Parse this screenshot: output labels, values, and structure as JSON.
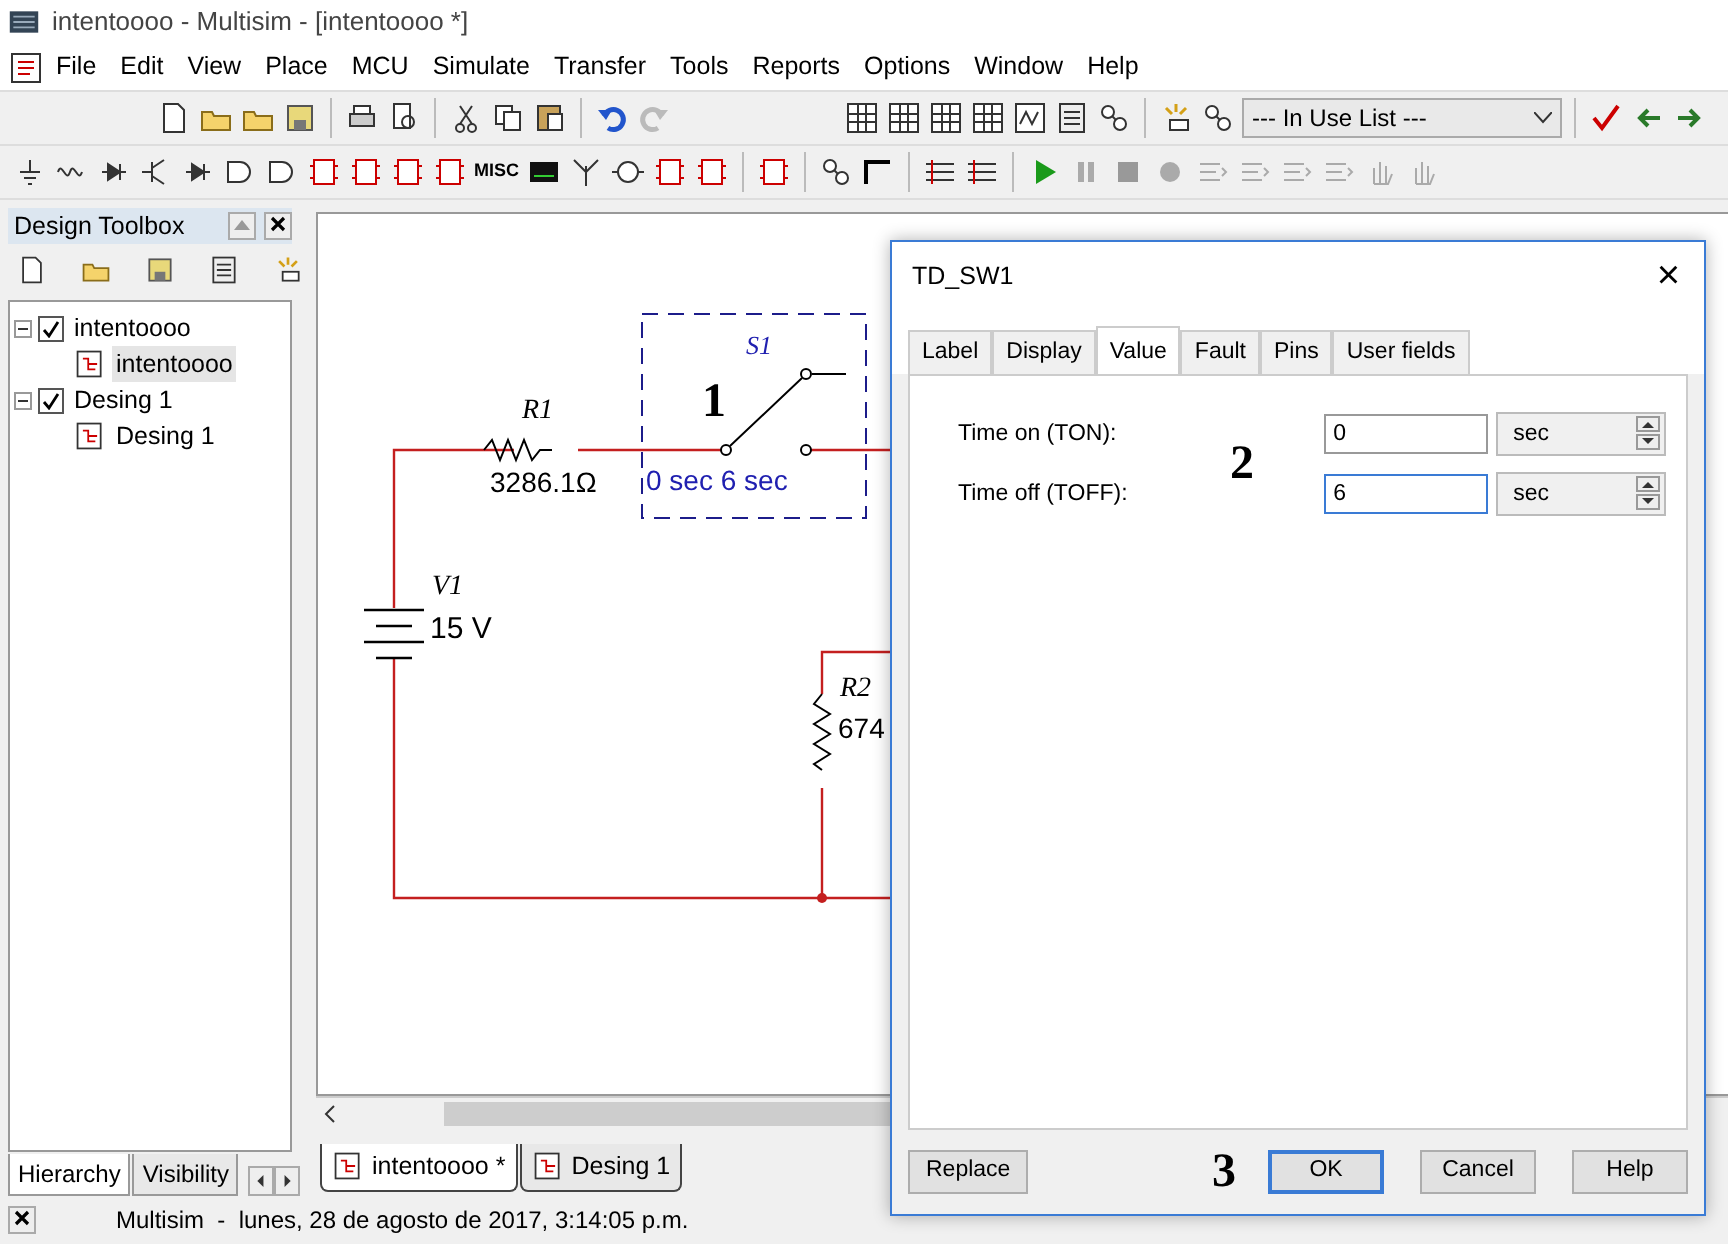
{
  "window": {
    "title": "intentoooo - Multisim - [intentoooo *]"
  },
  "menu": [
    "File",
    "Edit",
    "View",
    "Place",
    "MCU",
    "Simulate",
    "Transfer",
    "Tools",
    "Reports",
    "Options",
    "Window",
    "Help"
  ],
  "toolbar": {
    "in_use_list": "--- In Use List ---",
    "component_label": "MISC"
  },
  "design_toolbox": {
    "title": "Design Toolbox",
    "tree": [
      {
        "label": "intentoooo",
        "checked": true,
        "expanded": true,
        "children": [
          {
            "label": "intentoooo",
            "selected": true
          }
        ]
      },
      {
        "label": "Desing 1",
        "checked": true,
        "expanded": true,
        "children": [
          {
            "label": "Desing 1",
            "selected": false
          }
        ]
      }
    ],
    "tabs": [
      {
        "label": "Hierarchy",
        "selected": true
      },
      {
        "label": "Visibility",
        "selected": false
      }
    ]
  },
  "schematic": {
    "r1": {
      "ref": "R1",
      "value": "3286.1Ω"
    },
    "s1": {
      "ref": "S1",
      "value": "0 sec 6 sec",
      "closed": false
    },
    "v1": {
      "ref": "V1",
      "value": "15 V"
    },
    "r2": {
      "ref": "R2",
      "value": "674"
    },
    "callout": "1"
  },
  "document_tabs": [
    {
      "label": "intentoooo *",
      "selected": true
    },
    {
      "label": "Desing 1",
      "selected": false
    }
  ],
  "dialog": {
    "title": "TD_SW1",
    "close": "×",
    "tabs": [
      {
        "label": "Label",
        "selected": false
      },
      {
        "label": "Display",
        "selected": false
      },
      {
        "label": "Value",
        "selected": true
      },
      {
        "label": "Fault",
        "selected": false
      },
      {
        "label": "Pins",
        "selected": false
      },
      {
        "label": "User fields",
        "selected": false
      }
    ],
    "fields": [
      {
        "label": "Time on (TON):",
        "value": "0",
        "unit": "sec",
        "focused": false
      },
      {
        "label": "Time off (TOFF):",
        "value": "6",
        "unit": "sec",
        "focused": true
      }
    ],
    "callout": "2",
    "footer_callout": "3",
    "buttons": [
      {
        "label": "Replace",
        "default": false
      },
      {
        "label": "OK",
        "default": true
      },
      {
        "label": "Cancel",
        "default": false
      },
      {
        "label": "Help",
        "default": false
      }
    ]
  },
  "status_bar": {
    "text": "Multisim  -  lunes, 28 de agosto de 2017, 3:14:05 p.m."
  }
}
